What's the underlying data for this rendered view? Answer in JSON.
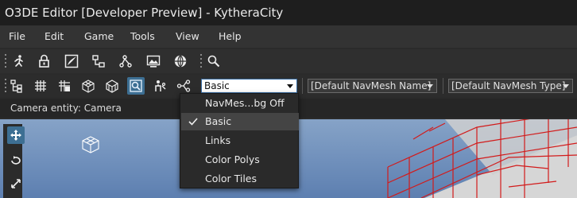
{
  "window": {
    "title": "O3DE Editor [Developer Preview] - KytheraCity"
  },
  "menubar": {
    "items": [
      "File",
      "Edit",
      "Game",
      "Tools",
      "View",
      "Help"
    ]
  },
  "toolbar_main": {
    "icons": [
      "run-icon",
      "lock-icon",
      "terrain-icon",
      "flowgraph-icon",
      "tracks-icon",
      "picture-icon",
      "globe-icon",
      "zoom-search-icon"
    ]
  },
  "toolbar_debug": {
    "icons": [
      "hierarchy-icon",
      "grid-icon",
      "grid-dots-icon",
      "cube-wire-icon",
      "cube-solid-icon",
      "navmesh-debug-icon",
      "agent-icon",
      "path-icon"
    ],
    "active_icon": "navmesh-debug-icon",
    "navmesh_debug_combo": {
      "value": "Basic"
    },
    "navmesh_name_combo": {
      "value": "[Default NavMesh Name]"
    },
    "navmesh_type_combo": {
      "value": "[Default NavMesh Type]"
    }
  },
  "viewport": {
    "header_label": "Camera entity: Camera",
    "side_icons": [
      "move-icon",
      "orbit-icon",
      "expand-icon"
    ]
  },
  "dropdown": {
    "options": [
      "NavMes...bg Off",
      "Basic",
      "Links",
      "Color Polys",
      "Color Tiles"
    ],
    "selected": "Basic"
  },
  "colors": {
    "accent": "#3d6f93",
    "selection": "#444444",
    "navmesh_wire": "#d21b1b"
  }
}
